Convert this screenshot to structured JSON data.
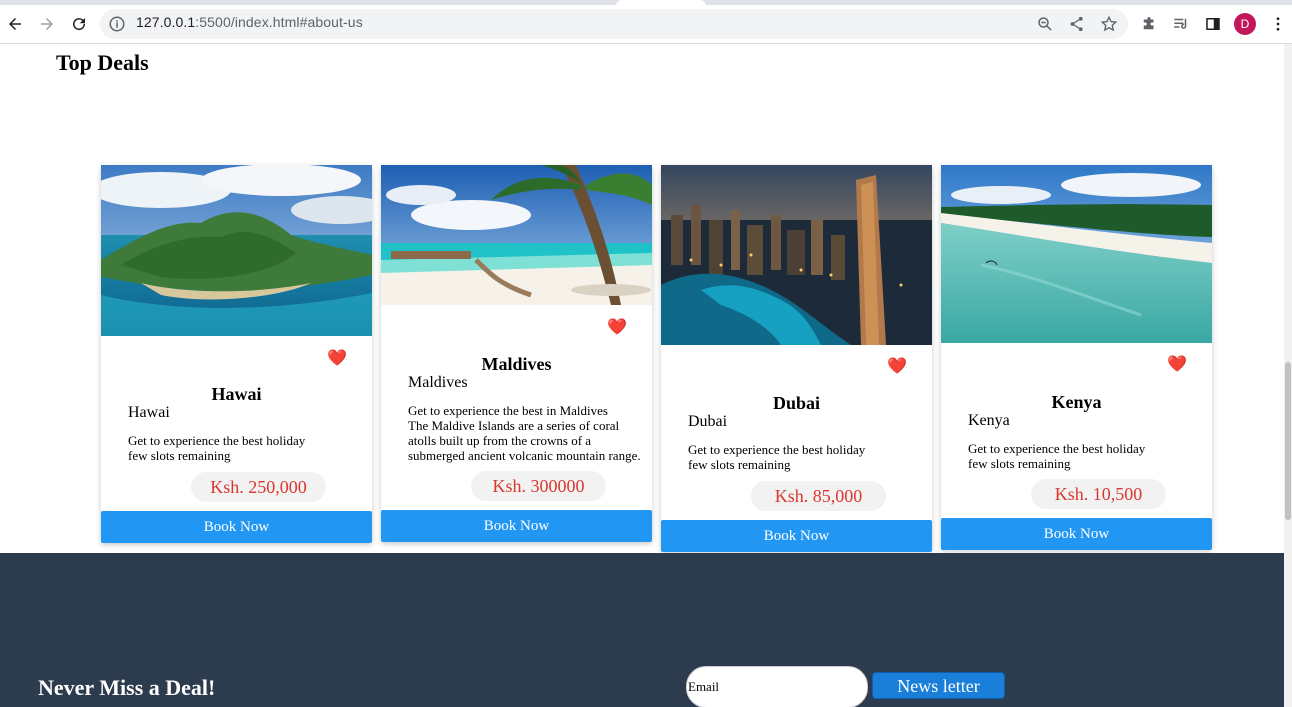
{
  "browser": {
    "url_host": "127.0.0.1",
    "url_rest": ":5500/index.html#about-us",
    "profile_initial": "D"
  },
  "page": {
    "section_title": "Top Deals",
    "heart_icon": "❤️",
    "cards": [
      {
        "name": "Hawai",
        "subname": "Hawai",
        "description": "Get to experience the best holiday\nfew slots remaining",
        "price": "Ksh. 250,000",
        "button": "Book Now"
      },
      {
        "name": "Maldives",
        "subname": "Maldives",
        "description": "Get to experience the best in Maldives\nThe Maldive Islands are a series of coral atolls built up from the crowns of a submerged ancient volcanic mountain range.",
        "price": "Ksh. 300000",
        "button": "Book Now"
      },
      {
        "name": "Dubai",
        "subname": "Dubai",
        "description": "Get to experience the best holiday\nfew slots remaining",
        "price": "Ksh. 85,000",
        "button": "Book Now"
      },
      {
        "name": "Kenya",
        "subname": "Kenya",
        "description": "Get to experience the best holiday\nfew slots remaining",
        "price": "Ksh. 10,500",
        "button": "Book Now"
      }
    ]
  },
  "footer": {
    "tagline": "Never Miss a Deal!",
    "email_placeholder": "Email",
    "newsletter_button": "News letter"
  },
  "colors": {
    "button_blue": "#2196f3",
    "price_red": "#d9372f",
    "footer_bg": "#2d3b4e"
  }
}
